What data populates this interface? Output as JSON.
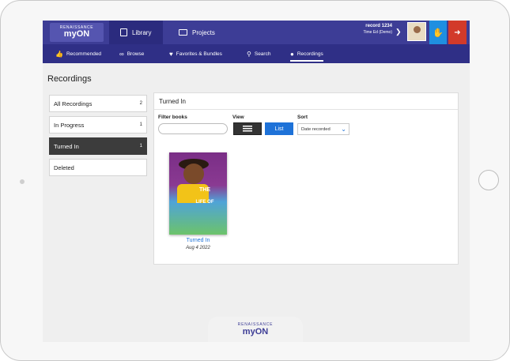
{
  "brand": {
    "top": "RENAISSANCE",
    "name": "myON"
  },
  "topnav": {
    "library": "Library",
    "projects": "Projects"
  },
  "user": {
    "name": "record 1234",
    "subtitle": "Time Ed (Demo)"
  },
  "subnav": [
    {
      "label": "Recommended",
      "icon": "thumbs-up"
    },
    {
      "label": "Browse",
      "icon": "glasses"
    },
    {
      "label": "Favorites & Bundles",
      "icon": "heart"
    },
    {
      "label": "Search",
      "icon": "search"
    },
    {
      "label": "Recordings",
      "icon": "speaker-head"
    }
  ],
  "page": {
    "title": "Recordings"
  },
  "sidebar": {
    "items": [
      {
        "label": "All Recordings",
        "count": "2"
      },
      {
        "label": "In Progress",
        "count": "1"
      },
      {
        "label": "Turned In",
        "count": "1"
      },
      {
        "label": "Deleted",
        "count": ""
      }
    ]
  },
  "panel": {
    "title": "Turned In",
    "filter_label": "Filter books",
    "view_label": "View",
    "list_label": "List",
    "sort_label": "Sort",
    "sort_value": "Date recorded"
  },
  "book": {
    "cover_title": "THE",
    "cover_title2": "LIFE OF",
    "status": "Turned In",
    "date": "Aug 4 2022"
  },
  "footer": {
    "top": "RENAISSANCE",
    "name": "myON"
  },
  "colors": {
    "nav": "#3d3d96",
    "subnav": "#2f2f86",
    "accent": "#1e72d8",
    "signout": "#d23a2a"
  }
}
